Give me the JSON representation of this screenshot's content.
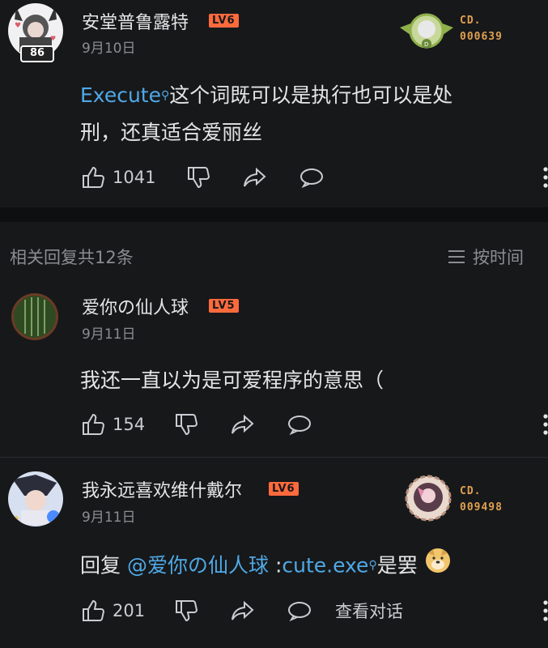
{
  "comment": {
    "username": "安堂普鲁露特",
    "level": "LV6",
    "date": "9月10日",
    "link_text": "Execute",
    "text_line1": "这个词既可以是执行也可以是处",
    "text_line2": "刑，还真适合爱丽丝",
    "likes": "1041",
    "fan_badge": {
      "label": "CD.",
      "number": "000639"
    },
    "avatar_badge": "86"
  },
  "replies_header": {
    "title": "相关回复共12条",
    "sort_label": "按时间"
  },
  "replies": [
    {
      "username": "爱你の仙人球",
      "level": "LV5",
      "date": "9月11日",
      "text": "我还一直以为是可爱程序的意思（",
      "likes": "154"
    },
    {
      "username": "我永远喜欢维什戴尔",
      "level": "LV6",
      "date": "9月11日",
      "reply_prefix": "回复",
      "mention": "@爱你の仙人球",
      "text_colon": ":",
      "link_text": "cute.exe",
      "text_suffix": "是罢",
      "likes": "201",
      "view_thread": "查看对话",
      "fan_badge": {
        "label": "CD.",
        "number": "009498"
      }
    }
  ],
  "colors": {
    "background": "#17181a",
    "link": "#4fa9e6",
    "level_badge": "#ff6a3d",
    "fan_badge_text": "#e0a050"
  }
}
